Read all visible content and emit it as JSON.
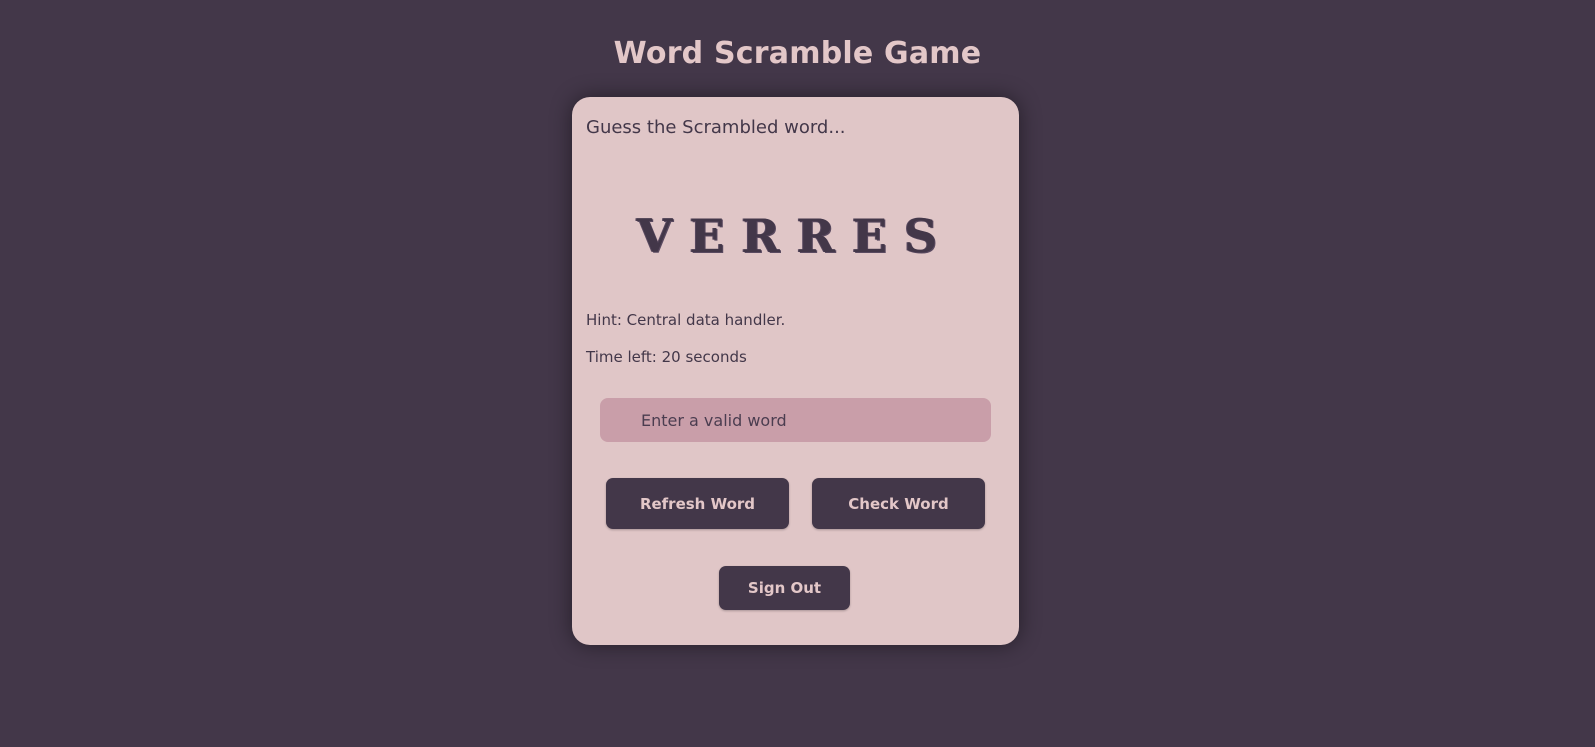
{
  "header": {
    "title": "Word Scramble Game"
  },
  "game": {
    "prompt": "Guess the Scrambled word...",
    "scrambled_word": "VERRES",
    "hint_label": "Hint:",
    "hint_text": "Central data handler.",
    "time_label": "Time left:",
    "time_value": "20",
    "time_unit": "seconds"
  },
  "input": {
    "placeholder": "Enter a valid word",
    "value": ""
  },
  "buttons": {
    "refresh_label": "Refresh Word",
    "check_label": "Check Word",
    "signout_label": "Sign Out"
  },
  "colors": {
    "background": "#433749",
    "card": "#e0c6c7",
    "input": "#c99ea9",
    "accent_text": "#e3c7c8"
  }
}
